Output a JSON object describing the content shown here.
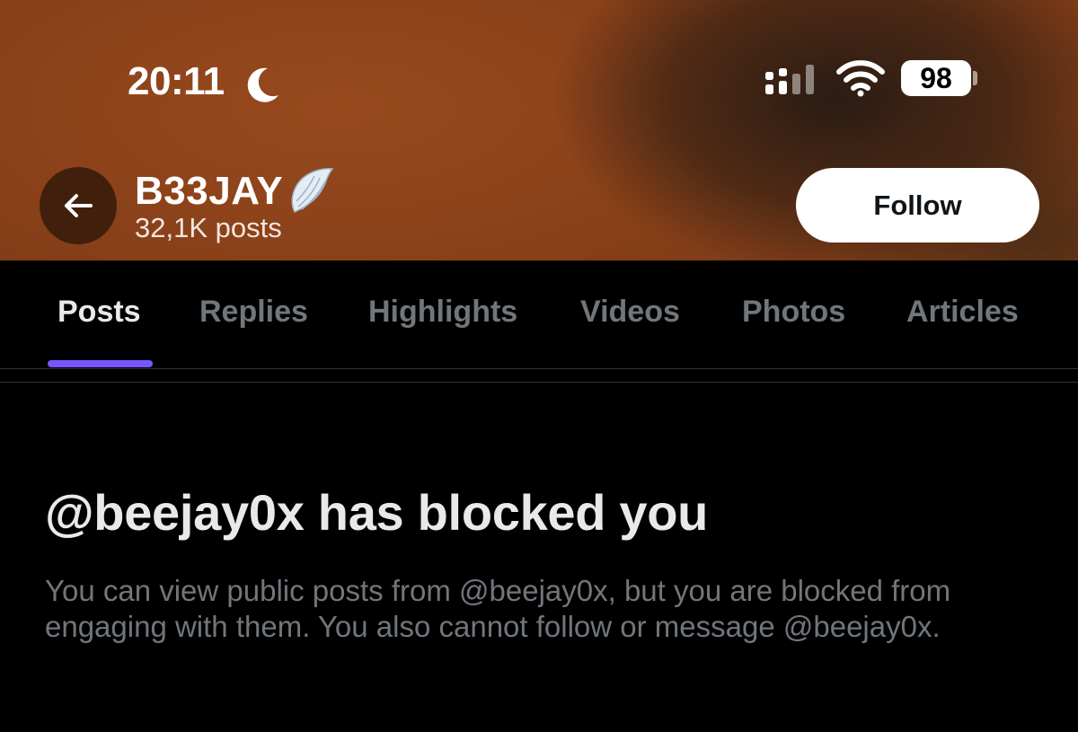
{
  "status_bar": {
    "time": "20:11",
    "battery": "98",
    "icons": [
      "moon-icon",
      "signal-icon",
      "wifi-icon",
      "battery-icon"
    ]
  },
  "header": {
    "back_icon": "arrow-left-icon",
    "name": "B33JAY",
    "name_badge_icon": "wing-icon",
    "posts_count": "32,1K posts",
    "follow_label": "Follow"
  },
  "tabs": [
    {
      "label": "Posts",
      "active": true
    },
    {
      "label": "Replies",
      "active": false
    },
    {
      "label": "Highlights",
      "active": false
    },
    {
      "label": "Videos",
      "active": false
    },
    {
      "label": "Photos",
      "active": false
    },
    {
      "label": "Articles",
      "active": false
    }
  ],
  "blocked": {
    "title": "@beejay0x has blocked you",
    "body": "You can view public posts from @beejay0x, but you are blocked from engaging with them. You also cannot follow or message @beejay0x."
  },
  "colors": {
    "accent": "#7856ff",
    "banner": "#8a4119",
    "background": "#000000",
    "muted_text": "#71767b"
  }
}
